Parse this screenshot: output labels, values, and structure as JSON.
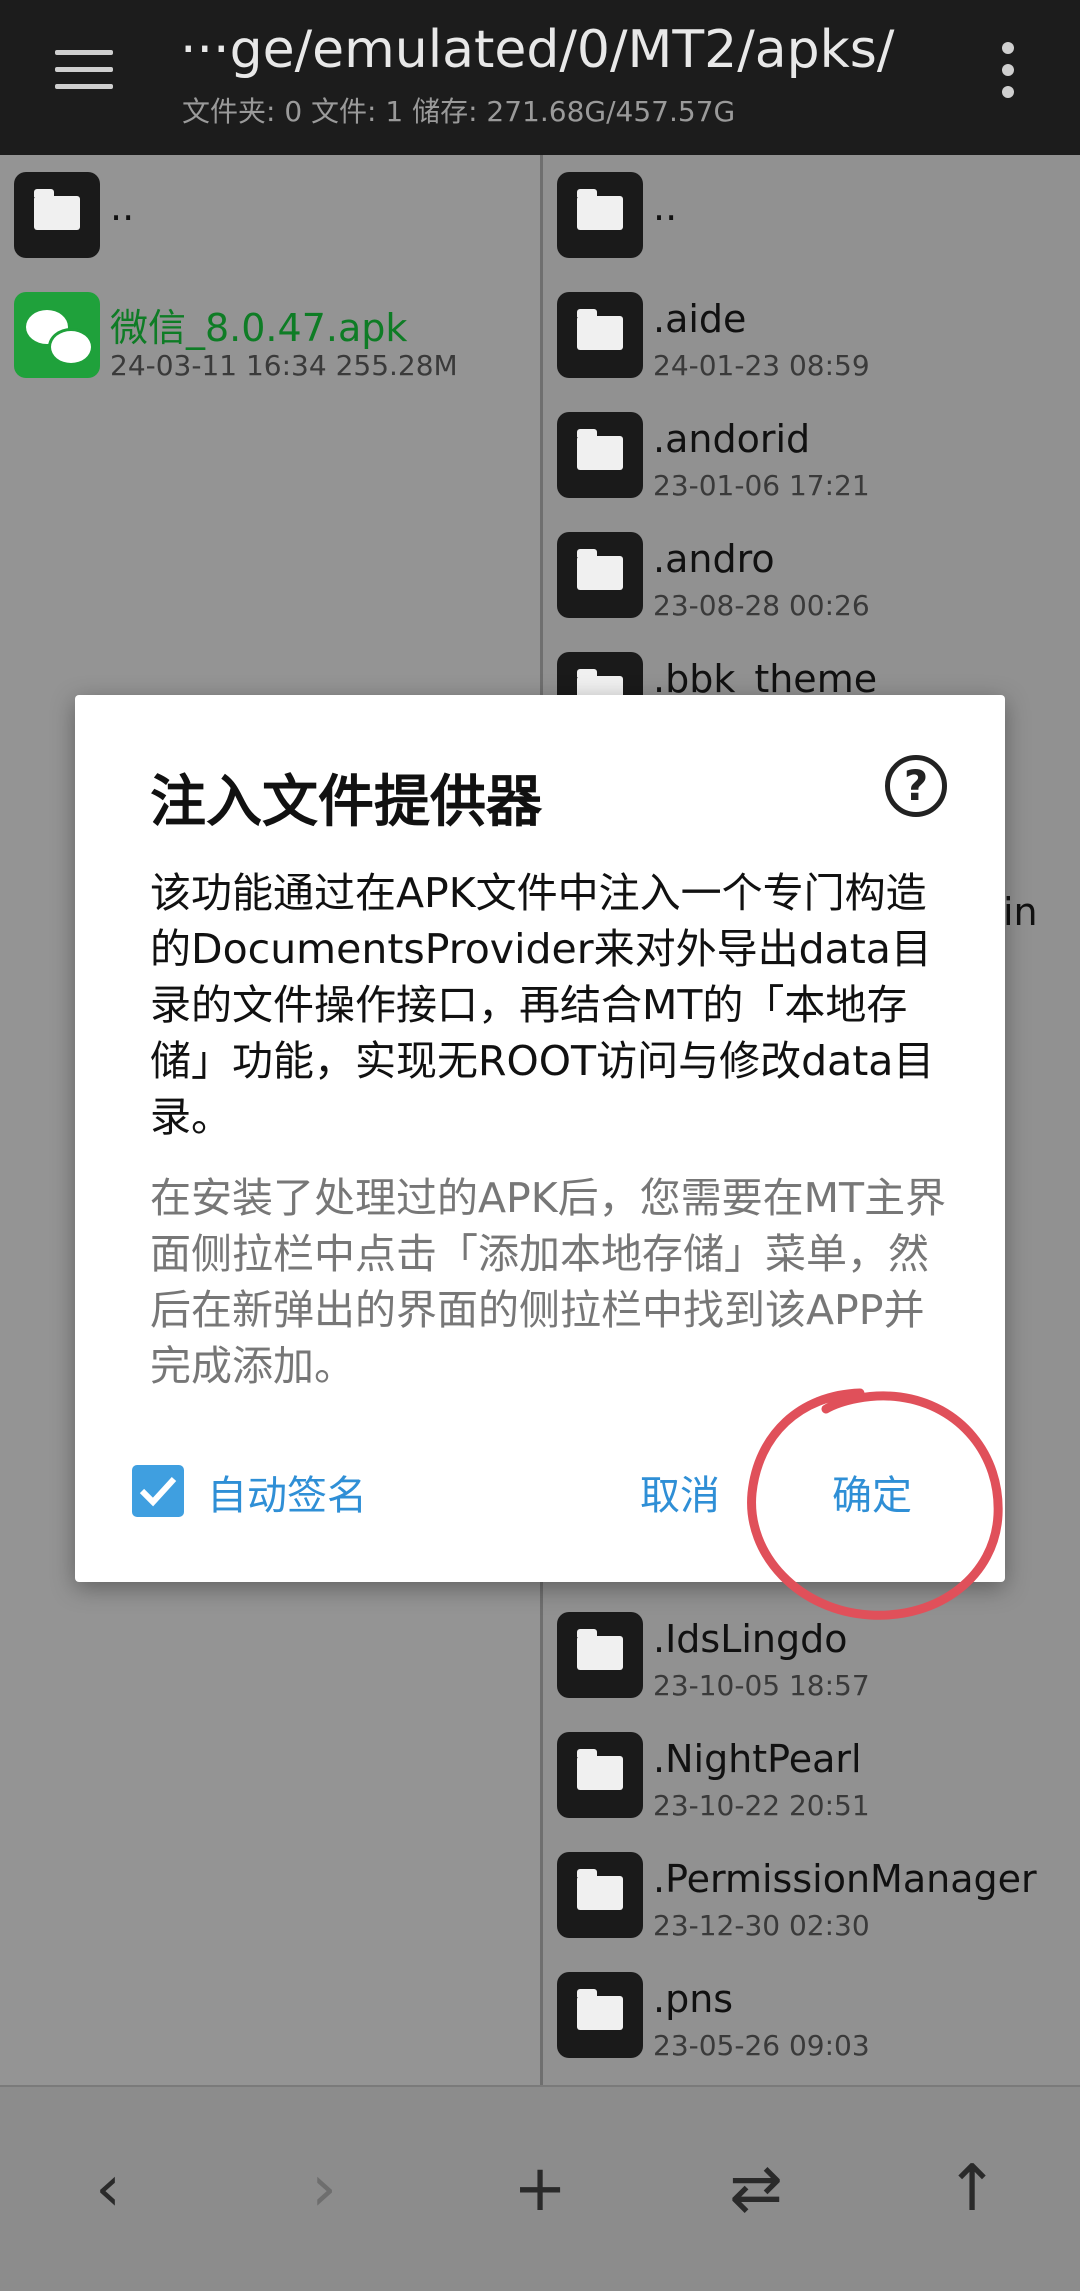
{
  "header": {
    "path": "···ge/emulated/0/MT2/apks/",
    "stats": "文件夹: 0  文件: 1  储存: 271.68G/457.57G"
  },
  "left_pane": {
    "parent": "..",
    "files": [
      {
        "name": "微信_8.0.47.apk",
        "meta": "24-03-11 16:34  255.28M",
        "icon": "wechat-icon"
      }
    ]
  },
  "right_pane": {
    "parent": "..",
    "folders_top": [
      {
        "name": ".aide",
        "meta": "24-01-23 08:59"
      },
      {
        "name": ".andorid",
        "meta": "23-01-06 17:21"
      },
      {
        "name": ".andro",
        "meta": "23-08-28 00:26"
      },
      {
        "name": ".bbk_theme",
        "meta": ""
      }
    ],
    "partial_text": "in",
    "folders_bottom": [
      {
        "name": ".IdsLingdo",
        "meta": "23-10-05 18:57"
      },
      {
        "name": ".NightPearl",
        "meta": "23-10-22 20:51"
      },
      {
        "name": ".PermissionManager",
        "meta": "23-12-30 02:30"
      },
      {
        "name": ".pns",
        "meta": "23-05-26 09:03"
      }
    ]
  },
  "dialog": {
    "title": "注入文件提供器",
    "help": "?",
    "body": "该功能通过在APK文件中注入一个专门构造的DocumentsProvider来对外导出data目录的文件操作接口，再结合MT的「本地存储」功能，实现无ROOT访问与修改data目录。",
    "note": "在安装了处理过的APK后，您需要在MT主界面侧拉栏中点击「添加本地存储」菜单，然后在新弹出的界面的侧拉栏中找到该APP并完成添加。",
    "checkbox_label": "自动签名",
    "checkbox_checked": true,
    "cancel_label": "取消",
    "ok_label": "确定"
  },
  "bottom_bar": {
    "back": "‹",
    "forward": "›",
    "add": "+",
    "swap": "⇄",
    "up": "↑"
  },
  "colors": {
    "accent": "#2f8fd6",
    "annotation": "#e0505a",
    "wechat": "#1fa13b"
  }
}
